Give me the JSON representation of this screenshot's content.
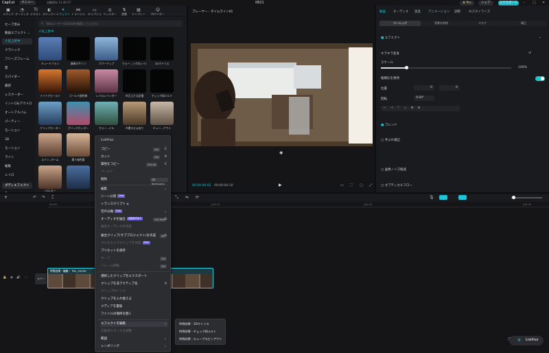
{
  "titlebar": {
    "app_name": "CapCut",
    "menu_label": "メニュー",
    "save_status": "自動保存 11:40:37",
    "window_title": "0821",
    "pro_label": "Pro",
    "share_label": "シェア",
    "export_label": "エクスポート"
  },
  "toolbar": {
    "tools": [
      {
        "label": "メディア",
        "icon": "media-icon"
      },
      {
        "label": "オーディオ",
        "icon": "audio-icon"
      },
      {
        "label": "テキスト",
        "icon": "text-icon"
      },
      {
        "label": "ステッカー",
        "icon": "sticker-icon"
      },
      {
        "label": "エフェクト",
        "icon": "effects-icon"
      },
      {
        "label": "トランジション",
        "icon": "transition-icon"
      },
      {
        "label": "キャプション",
        "icon": "caption-icon"
      },
      {
        "label": "フィルター",
        "icon": "filter-icon"
      },
      {
        "label": "調整",
        "icon": "adjust-icon"
      },
      {
        "label": "テンプレート",
        "icon": "template-icon"
      },
      {
        "label": "AIアバター",
        "icon": "ai-avatar-icon"
      }
    ]
  },
  "leftnav": {
    "items": [
      "セーブ済み",
      "動画エフェクト ⌄",
      "人気上昇中",
      "クラシック",
      "フリーズフレーム",
      "夏",
      "スパイダー",
      "最新",
      "レスクーダー",
      "イントロ&アウトロ",
      "オートアルバム",
      "パーティー",
      "モーション",
      "3D",
      "モーション",
      "ライト",
      "編集",
      "レトロ",
      "ボディエフェクト ⌄"
    ]
  },
  "search": {
    "placeholder": "他のユーザーの1Gのbを検索してください"
  },
  "effects": {
    "section_title": "人気上昇中",
    "items": [
      "ミュードフラン",
      "演奏のサイン",
      "パワーアップ",
      "ウォー...ングのレベル",
      "3Dマトリス",
      "ファイアビースト",
      "ゴールド超特典",
      "レトロレインボー",
      "炎天上ける記憶",
      "チェック斜メルト",
      "フリップモーター",
      "グリッチカッター",
      "カラー...イル",
      "炎雲ヨヒ◎あり",
      "キュー...アウト",
      "スイン..ポーム",
      "舞う緑色葉",
      "",
      "",
      "",
      "ハロ-ロー",
      "",
      "",
      "",
      ""
    ]
  },
  "player": {
    "title": "プレーヤー - タイムライン01",
    "time_current": "00:00:00:02",
    "time_total": "00:00:00:10"
  },
  "props": {
    "tabs": [
      "動画",
      "オーディオ",
      "速度",
      "アニメーション",
      "調整",
      "AIスタイライズ"
    ],
    "subtabs": [
      "ベーシック",
      "背景を削除",
      "マスク",
      "補正"
    ],
    "section_effects": "エフェクト",
    "section_transform": "キラキラ変身",
    "scale_label": "スケール",
    "scale_value": "100%",
    "uniform_scale_label": "縦横比を保持",
    "position_label": "位置",
    "pos_x": "0",
    "pos_y": "0",
    "rotation_label": "回転",
    "rotation_value": "0.00°",
    "section_blend": "ブレンド",
    "stabilize_label": "手ぶれ補正",
    "noise_label": "画像ノイズ軽減",
    "optical_flow_label": "オプティカルフロー"
  },
  "timeline": {
    "ruler": [
      "00:00",
      "|00:10",
      "|00:20",
      "|00:30"
    ],
    "cover_label": "カバー",
    "clip_label": "特殊効果・編集・ PXL_20250"
  },
  "context_menu": {
    "title": "EditPilot",
    "items": [
      {
        "label": "コピー",
        "kbd": "Ctrl",
        "key": "C",
        "disabled": false
      },
      {
        "label": "カット",
        "kbd": "Ctrl",
        "key": "X",
        "disabled": false
      },
      {
        "label": "属性をコピー",
        "kbd": "Ctrl Alt",
        "key": "C",
        "disabled": false
      },
      {
        "label": "ペースト",
        "kbd": "",
        "key": "",
        "disabled": true
      },
      {
        "label": "削除",
        "kbd": "⌫ Backspace",
        "key": "",
        "disabled": false
      },
      {
        "label": "編集",
        "kbd": "",
        "key": "",
        "disabled": false,
        "submenu": true
      },
      {
        "label": "シーン分割",
        "badge": "Free",
        "disabled": false
      },
      {
        "label": "トランスクリプト",
        "badge": "",
        "disabled": false
      },
      {
        "label": "音声分離",
        "badge": "Free",
        "disabled": false,
        "submenu": true
      },
      {
        "label": "オーディオを抽出",
        "badge": "自動音声あり",
        "kbd": "Ctrl Shift",
        "key": "S",
        "disabled": false
      },
      {
        "label": "複合オーディオを作成",
        "disabled": true
      },
      {
        "label": "複合クリップ(サブプロジェクト)を作成",
        "kbd": "Alt",
        "key": "G",
        "disabled": false
      },
      {
        "label": "マルチカメラクリップを作成",
        "badge": "Free",
        "disabled": true
      },
      {
        "label": "プリセットを保存",
        "disabled": false
      },
      {
        "label": "キーフ",
        "kbd": "Ctrl",
        "key": "",
        "disabled": true
      },
      {
        "label": "フレーム移動",
        "kbd": "Ctrl",
        "key": "",
        "disabled": true
      },
      {
        "label": "選択したクリップをエクスポート",
        "disabled": false
      },
      {
        "label": "クリップを非アクティブ化",
        "key": "V",
        "disabled": false
      },
      {
        "label": "クリップのリンク",
        "disabled": true
      },
      {
        "label": "クリップを入れ替える",
        "disabled": false
      },
      {
        "label": "メディアを置換",
        "disabled": false
      },
      {
        "label": "ファイルの場所を開く",
        "disabled": false
      },
      {
        "label": "エフェクトを編集",
        "disabled": false,
        "submenu": true
      },
      {
        "label": "元素材スタイルを調整",
        "disabled": true
      },
      {
        "label": "範囲",
        "disabled": false,
        "submenu": true
      },
      {
        "label": "レンダリング",
        "disabled": false,
        "submenu": true
      }
    ]
  },
  "submenu": {
    "items": [
      "特殊効果 - 3Dマトリス",
      "特殊効果 - チェック斜メルト",
      "特殊効果 - キューブスピンアウト"
    ]
  },
  "editpilot_label": "EditPilot",
  "colors": {
    "accent": "#1fc4d6",
    "pro_badge": "#6a5fd8",
    "clip_border": "#22d0e0"
  }
}
